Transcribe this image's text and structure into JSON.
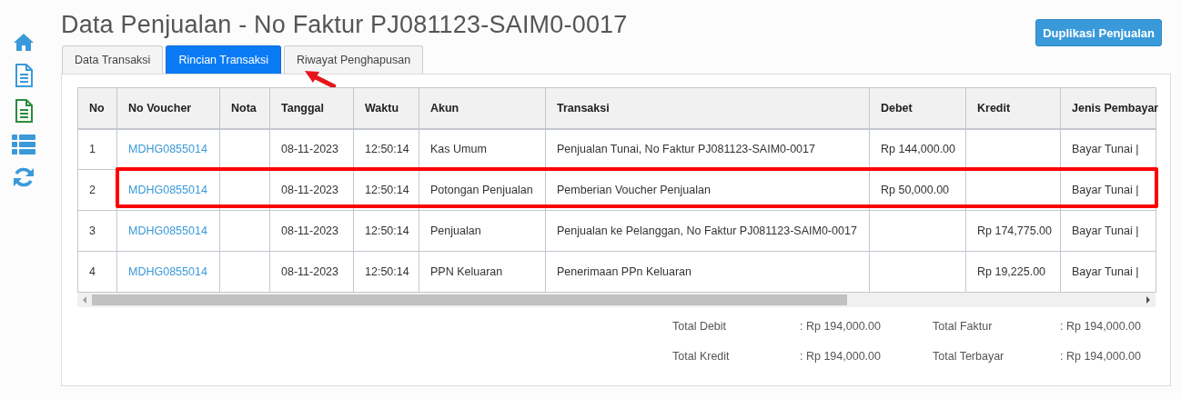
{
  "title": "Data Penjualan - No Faktur PJ081123-SAIM0-0017",
  "action_button": "Duplikasi Penjualan",
  "sidebar": [
    {
      "kind": "home"
    },
    {
      "kind": "document"
    },
    {
      "kind": "sheet"
    },
    {
      "kind": "list"
    },
    {
      "kind": "refresh"
    }
  ],
  "tabs": [
    {
      "label": "Data Transaksi",
      "selected": false
    },
    {
      "label": "Rincian Transaksi",
      "selected": true
    },
    {
      "label": "Riwayat Penghapusan",
      "selected": false
    }
  ],
  "table": {
    "columns": [
      "No",
      "No Voucher",
      "Nota",
      "Tanggal",
      "Waktu",
      "Akun",
      "Transaksi",
      "Debet",
      "Kredit",
      "Jenis Pembayar"
    ],
    "rows": [
      {
        "highlighted": false,
        "cells": [
          "1",
          "MDHG0855014",
          "",
          "08-11-2023",
          "12:50:14",
          "Kas Umum",
          "Penjualan Tunai, No Faktur PJ081123-SAIM0-0017",
          "Rp 144,000.00",
          "",
          "Bayar Tunai |"
        ]
      },
      {
        "highlighted": true,
        "cells": [
          "2",
          "MDHG0855014",
          "",
          "08-11-2023",
          "12:50:14",
          "Potongan Penjualan",
          "Pemberian Voucher Penjualan",
          "Rp 50,000.00",
          "",
          "Bayar Tunai |"
        ]
      },
      {
        "highlighted": false,
        "cells": [
          "3",
          "MDHG0855014",
          "",
          "08-11-2023",
          "12:50:14",
          "Penjualan",
          "Penjualan ke Pelanggan, No Faktur PJ081123-SAIM0-0017",
          "",
          "Rp 174,775.00",
          "Bayar Tunai |"
        ]
      },
      {
        "highlighted": false,
        "cells": [
          "4",
          "MDHG0855014",
          "",
          "08-11-2023",
          "12:50:14",
          "PPN Keluaran",
          "Penerimaan PPn Keluaran",
          "",
          "Rp 19,225.00",
          "Bayar Tunai |"
        ]
      }
    ]
  },
  "totals": [
    {
      "label": "Total Debit",
      "value": ": Rp 194,000.00"
    },
    {
      "label": "Total Faktur",
      "value": ": Rp 194,000.00"
    },
    {
      "label": "Total Kredit",
      "value": ": Rp 194,000.00"
    },
    {
      "label": "Total Terbayar",
      "value": ": Rp 194,000.00"
    }
  ]
}
